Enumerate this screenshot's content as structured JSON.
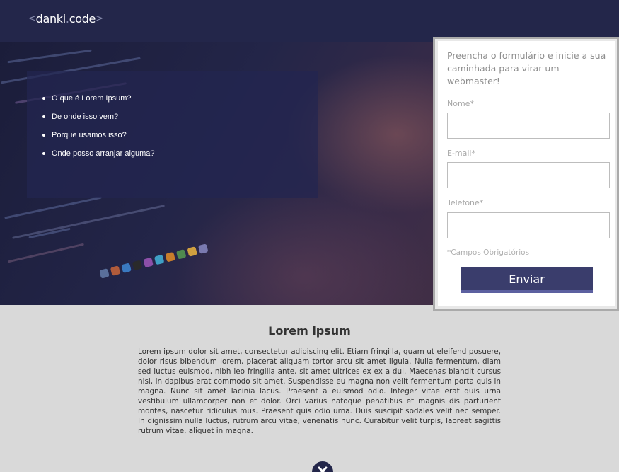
{
  "header": {
    "logo": {
      "prefix": "<",
      "word1": "danki",
      "dot": ".",
      "word2": "code",
      "suffix": ">"
    }
  },
  "hero": {
    "topics": [
      "O que é Lorem Ipsum?",
      "De onde isso vem?",
      "Porque usamos isso?",
      "Onde posso arranjar alguma?"
    ]
  },
  "form": {
    "intro": "Preencha o formulário e inicie a sua caminhada para virar um webmaster!",
    "fields": [
      {
        "label": "Nome*",
        "value": ""
      },
      {
        "label": "E-mail*",
        "value": ""
      },
      {
        "label": "Telefone*",
        "value": ""
      }
    ],
    "required_note": "*Campos Obrigatórios",
    "submit_label": "Enviar"
  },
  "content": {
    "title": "Lorem ipsum",
    "paragraph": "Lorem ipsum dolor sit amet, consectetur adipiscing elit. Etiam fringilla, quam ut eleifend posuere, dolor risus bibendum lorem, placerat aliquam tortor arcu sit amet ligula. Nulla fermentum, diam sed luctus euismod, nibh leo fringilla ante, sit amet ultrices ex ex a dui. Maecenas blandit cursus nisi, in dapibus erat commodo sit amet. Suspendisse eu magna non velit fermentum porta quis in magna. Nunc sit amet lacinia lacus. Praesent a euismod odio. Integer vitae erat quis urna vestibulum ullamcorper non et dolor. Orci varius natoque penatibus et magnis dis parturient montes, nascetur ridiculus mus. Praesent quis odio urna. Duis suscipit sodales velit nec semper. In dignissim nulla luctus, rutrum arcu vitae, venenatis nunc. Curabitur velit turpis, laoreet sagittis rutrum vitae, aliquet in magna."
  },
  "icons": {
    "bottom": "close-icon"
  },
  "colors": {
    "header_bg": "#23264a",
    "button_bg": "#3a3d6c",
    "page_bg": "#d9d9d9"
  }
}
